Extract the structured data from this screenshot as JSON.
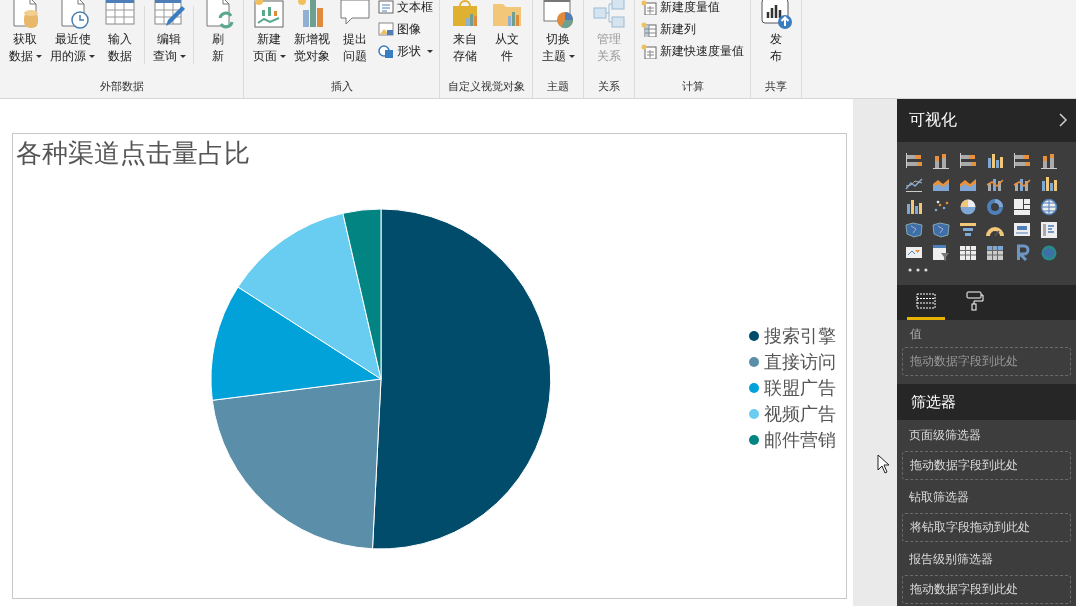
{
  "ribbon": {
    "groups": [
      {
        "label": "外部数据",
        "items": [
          {
            "kind": "large",
            "lines": [
              "获取",
              "数据"
            ],
            "dropdown": true,
            "disabled": false
          },
          {
            "kind": "large",
            "lines": [
              "最近使",
              "用的源"
            ],
            "dropdown": true,
            "disabled": false
          },
          {
            "kind": "large",
            "lines": [
              "输入",
              "数据"
            ],
            "dropdown": false,
            "disabled": false
          },
          {
            "kind": "separator"
          },
          {
            "kind": "large",
            "lines": [
              "编辑",
              "查询"
            ],
            "dropdown": true,
            "disabled": false
          },
          {
            "kind": "separator"
          },
          {
            "kind": "large",
            "lines": [
              "刷",
              "新"
            ],
            "dropdown": false,
            "disabled": false
          }
        ]
      },
      {
        "label": "插入",
        "items": [
          {
            "kind": "large",
            "lines": [
              "新建",
              "页面"
            ],
            "dropdown": true,
            "disabled": false
          },
          {
            "kind": "large",
            "lines": [
              "新增视",
              "觉对象"
            ],
            "dropdown": false,
            "disabled": false
          },
          {
            "kind": "large",
            "lines": [
              "提出",
              "问题"
            ],
            "dropdown": false,
            "disabled": false
          },
          {
            "kind": "small-stack",
            "entries": [
              {
                "label": "文本框",
                "dropdown": false
              },
              {
                "label": "图像",
                "dropdown": false
              },
              {
                "label": "形状",
                "dropdown": true
              }
            ]
          }
        ]
      },
      {
        "label": "自定义视觉对象",
        "items": [
          {
            "kind": "large",
            "lines": [
              "来自",
              "存储"
            ],
            "dropdown": false,
            "disabled": false
          },
          {
            "kind": "large",
            "lines": [
              "从文",
              "件"
            ],
            "dropdown": false,
            "disabled": false
          }
        ]
      },
      {
        "label": "主题",
        "items": [
          {
            "kind": "large",
            "lines": [
              "切换",
              "主题"
            ],
            "dropdown": true,
            "disabled": false
          }
        ]
      },
      {
        "label": "关系",
        "items": [
          {
            "kind": "large",
            "lines": [
              "管理",
              "关系"
            ],
            "dropdown": false,
            "disabled": true
          }
        ]
      },
      {
        "label": "计算",
        "items": [
          {
            "kind": "small-stack",
            "entries": [
              {
                "label": "新建度量值",
                "dropdown": false
              },
              {
                "label": "新建列",
                "dropdown": false
              },
              {
                "label": "新建快速度量值",
                "dropdown": false
              }
            ]
          }
        ]
      },
      {
        "label": "共享",
        "items": [
          {
            "kind": "large",
            "lines": [
              "发",
              "布"
            ],
            "dropdown": false,
            "disabled": false
          }
        ]
      }
    ]
  },
  "visual": {
    "title": "各种渠道点击量占比",
    "legend": [
      {
        "label": "搜索引擎",
        "color": "#004c6a"
      },
      {
        "label": "直接访问",
        "color": "#5b8ea8"
      },
      {
        "label": "联盟广告",
        "color": "#01a2d9"
      },
      {
        "label": "视频广告",
        "color": "#69cdf2"
      },
      {
        "label": "邮件营销",
        "color": "#018482"
      }
    ]
  },
  "visualizations_pane": {
    "title": "可视化",
    "tabs": [
      {
        "kind": "fields",
        "selected": true
      },
      {
        "kind": "format",
        "selected": false
      }
    ],
    "wells": [
      {
        "label": "值",
        "drop_text": "拖动数据字段到此处"
      }
    ]
  },
  "filters_pane": {
    "title": "筛选器",
    "sections": [
      {
        "label": "页面级筛选器",
        "drop_text": "拖动数据字段到此处"
      },
      {
        "label": "钻取筛选器",
        "drop_text": "将钻取字段拖动到此处"
      },
      {
        "label": "报告级别筛选器",
        "drop_text": "拖动数据字段到此处"
      }
    ]
  }
}
